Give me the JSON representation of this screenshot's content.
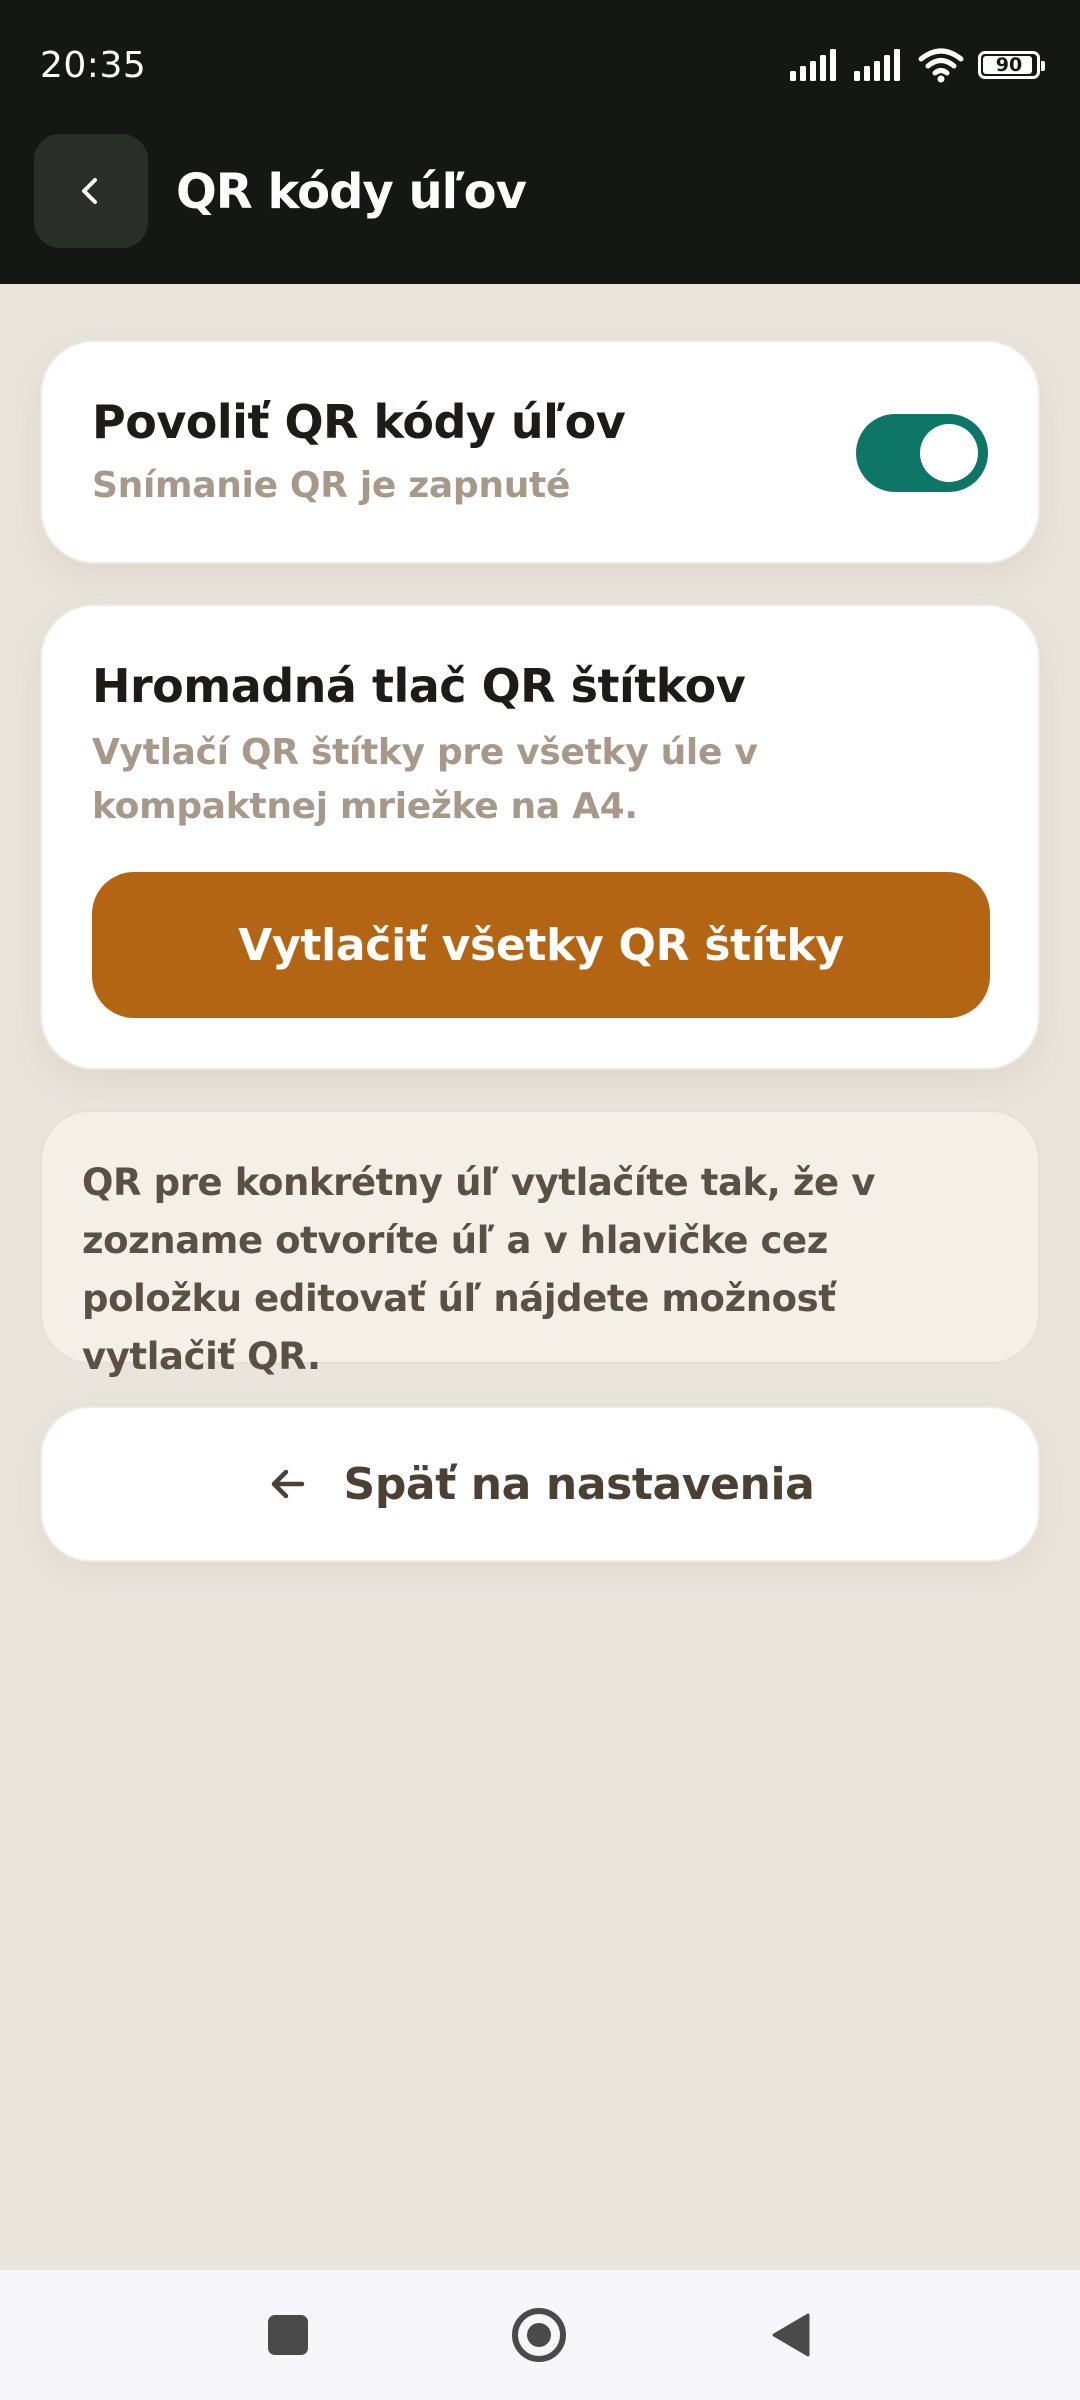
{
  "status_bar": {
    "time": "20:35",
    "battery": "90",
    "icons": [
      "signal-icon",
      "signal-icon",
      "wifi-icon",
      "battery-icon"
    ]
  },
  "app_bar": {
    "title": "QR kódy úľov",
    "back_icon": "chevron-left-icon"
  },
  "qr_toggle_card": {
    "title": "Povoliť QR kódy úľov",
    "subtitle": "Snímanie QR je zapnuté",
    "toggle_on": true,
    "accent_color": "#0E7666"
  },
  "bulk_print_card": {
    "title": "Hromadná tlač QR štítkov",
    "description": "Vytlačí QR štítky pre všetky úle v kompaktnej mriežke na A4.",
    "button_label": "Vytlačiť všetky QR štítky",
    "button_color": "#B46513"
  },
  "info_box": {
    "text": "QR pre konkrétny úľ vytlačíte tak, že v zozname otvoríte úľ a v hlavičke cez položku editovať úľ nájdete možnosť vytlačiť QR."
  },
  "back_to_settings": {
    "label": "Späť na nastavenia",
    "icon": "arrow-left-icon"
  },
  "nav_bar": {
    "buttons": [
      "recents-button",
      "home-button",
      "back-button"
    ]
  }
}
